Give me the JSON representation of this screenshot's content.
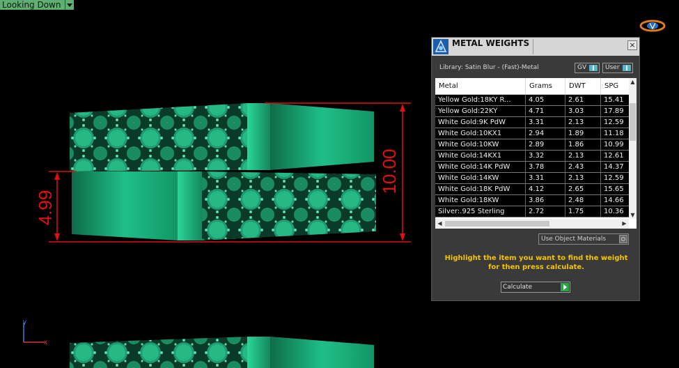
{
  "viewport": {
    "view_label": "Looking Down",
    "dimension_left": "4.99",
    "dimension_right": "10.00",
    "axis_y": "y",
    "axis_x": "x"
  },
  "panel": {
    "title": "METAL WEIGHTS",
    "close": "×",
    "library": "Library: Satin Blur - (Fast)-Metal",
    "toggle_gv": "GV",
    "toggle_user": "User",
    "columns": [
      "Metal",
      "Grams",
      "DWT",
      "SPG"
    ],
    "rows": [
      {
        "metal": "Yellow Gold:18KY R...",
        "grams": "4.05",
        "dwt": "2.61",
        "spg": "15.41"
      },
      {
        "metal": "Yellow Gold:22KY",
        "grams": "4.71",
        "dwt": "3.03",
        "spg": "17.89"
      },
      {
        "metal": "White Gold:9K PdW",
        "grams": "3.31",
        "dwt": "2.13",
        "spg": "12.59"
      },
      {
        "metal": "White Gold:10KX1",
        "grams": "2.94",
        "dwt": "1.89",
        "spg": "11.18"
      },
      {
        "metal": "White Gold:10KW",
        "grams": "2.89",
        "dwt": "1.86",
        "spg": "10.99"
      },
      {
        "metal": "White Gold:14KX1",
        "grams": "3.32",
        "dwt": "2.13",
        "spg": "12.61"
      },
      {
        "metal": "White Gold:14K PdW",
        "grams": "3.78",
        "dwt": "2.43",
        "spg": "14.37"
      },
      {
        "metal": "White Gold:14KW",
        "grams": "3.31",
        "dwt": "2.13",
        "spg": "12.59"
      },
      {
        "metal": "White Gold:18K PdW",
        "grams": "4.12",
        "dwt": "2.65",
        "spg": "15.65"
      },
      {
        "metal": "White Gold:18KW",
        "grams": "3.86",
        "dwt": "2.48",
        "spg": "14.66"
      },
      {
        "metal": "Silver:.925 Sterling",
        "grams": "2.72",
        "dwt": "1.75",
        "spg": "10.36"
      }
    ],
    "use_object_materials": "Use Object Materials",
    "hint": "Highlight the item you want to find the weight for then press calculate.",
    "calculate": "Calculate"
  },
  "colors": {
    "model_green": "#1fa87a",
    "dimension_red": "#e01010",
    "hint_yellow": "#f5c400",
    "toggle_blue": "#5ab3c9",
    "calc_green": "#2fa54a"
  }
}
